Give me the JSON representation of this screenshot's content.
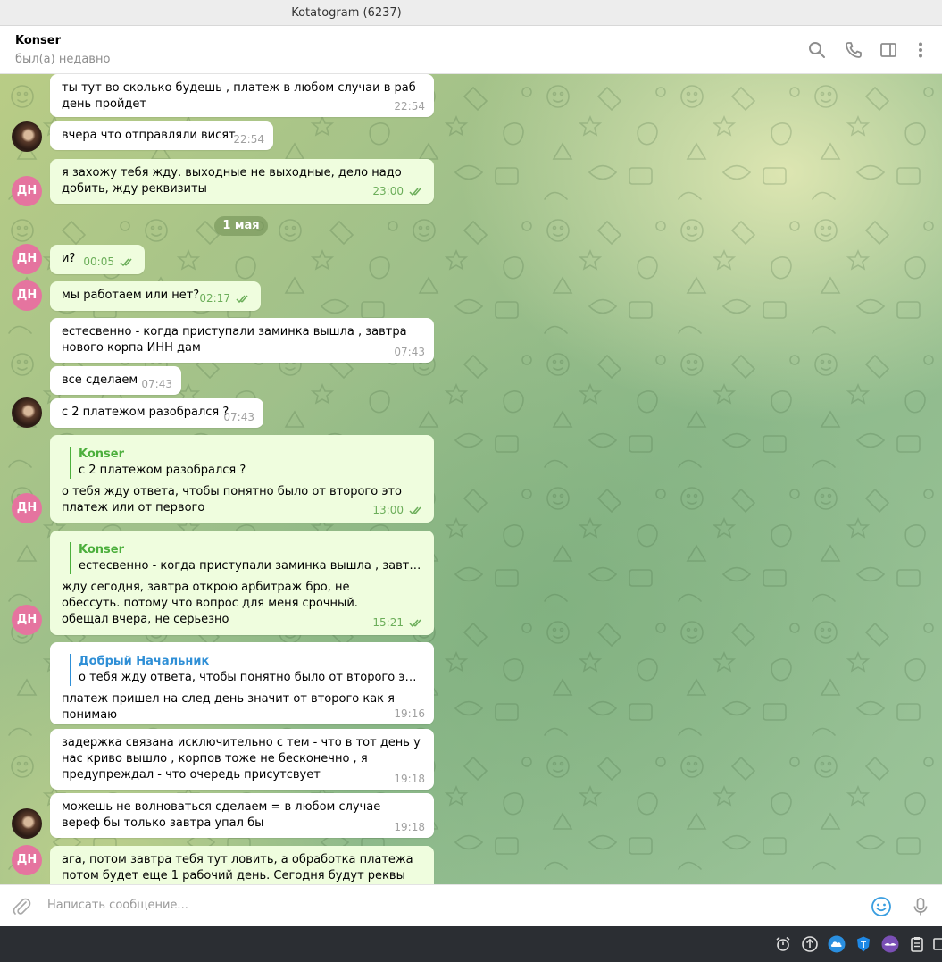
{
  "window": {
    "title": "Kotatogram (6237)"
  },
  "header": {
    "name": "Konser",
    "status": "был(а) недавно"
  },
  "icons": {
    "search": "search-icon",
    "call": "phone-icon",
    "sidebar": "sidebar-toggle-icon",
    "menu": "more-vertical-icon",
    "attach": "paperclip-icon",
    "emoji": "emoji-icon",
    "mic": "microphone-icon"
  },
  "avatar_initials": "ДН",
  "date_separator": "1 мая",
  "messages": [
    {
      "text": "ты тут во сколько будешь , платеж в любом случаи в раб день пройдет",
      "time": "22:54"
    },
    {
      "text": "вчера что отправляли висят",
      "time": "22:54"
    },
    {
      "text": "я захожу тебя жду. выходные не выходные, дело надо добить, жду реквизиты",
      "time": "23:00"
    },
    {
      "text": "и?",
      "time": "00:05"
    },
    {
      "text": "мы работаем или нет?",
      "time": "02:17"
    },
    {
      "text": "естесвенно - когда приступали заминка вышла ,  завтра нового корпа ИНН дам",
      "time": "07:43"
    },
    {
      "text": "все сделаем",
      "time": "07:43"
    },
    {
      "text": "с 2 платежом разобрался ?",
      "time": "07:43"
    },
    {
      "reply_name": "Konser",
      "reply_text": "с 2 платежом разобрался ?",
      "text": "о тебя жду ответа, чтобы понятно было от второго это платеж или от первого",
      "time": "13:00"
    },
    {
      "reply_name": "Konser",
      "reply_text": "естесвенно - когда приступали заминка вышла ,  завтра нов…",
      "text": "жду сегодня, завтра открою арбитраж бро, не обессуть. потому что вопрос для меня срочный. обещал вчера, не серьезно",
      "time": "15:21"
    },
    {
      "reply_name": "Добрый Начальник",
      "reply_text": "о тебя жду ответа, чтобы понятно было от второго это плат…",
      "text": "платеж пришел на след день значит от второго как я понимаю",
      "time": "19:16"
    },
    {
      "text": "задержка связана исключительно с тем - что в тот день у нас криво вышло , корпов тоже не бесконечно , я предупреждал - что очередь присутсвует",
      "time": "19:18"
    },
    {
      "text": "можешь не волноваться сделаем = в любом случае вереф бы только завтра упал бы",
      "time": "19:18"
    },
    {
      "text": "ага, потом завтра тебя тут ловить, а обработка платежа потом будет еще 1 рабочий день. Сегодня будут реквы или нет?",
      "time": ""
    }
  ],
  "composer": {
    "placeholder": "Написать сообщение..."
  },
  "colors": {
    "outgoing_bubble": "#effdde",
    "incoming_bubble": "#ffffff",
    "accent_green": "#4caf3c",
    "accent_blue": "#2f8fd6",
    "avatar_pink": "#e5749f"
  }
}
